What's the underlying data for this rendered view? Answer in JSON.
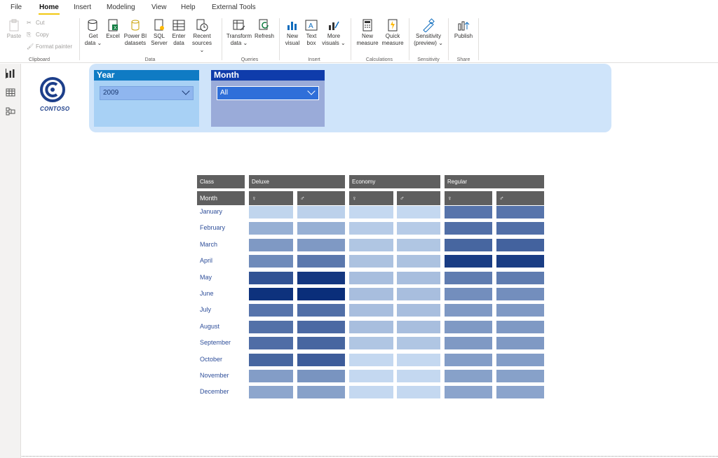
{
  "menu": {
    "tabs": [
      "File",
      "Home",
      "Insert",
      "Modeling",
      "View",
      "Help",
      "External Tools"
    ]
  },
  "ribbon": {
    "clipboard": {
      "label": "Clipboard",
      "paste": "Paste",
      "cut": "Cut",
      "copy": "Copy",
      "format_painter": "Format painter"
    },
    "data": {
      "label": "Data",
      "get_data": [
        "Get",
        "data ⌄"
      ],
      "excel": "Excel",
      "power_bi": [
        "Power BI",
        "datasets"
      ],
      "sql": [
        "SQL",
        "Server"
      ],
      "enter": [
        "Enter",
        "data"
      ],
      "recent": [
        "Recent",
        "sources ⌄"
      ]
    },
    "queries": {
      "label": "Queries",
      "transform": [
        "Transform",
        "data ⌄"
      ],
      "refresh": "Refresh"
    },
    "insert": {
      "label": "Insert",
      "new_visual": [
        "New",
        "visual"
      ],
      "text_box": [
        "Text",
        "box"
      ],
      "more_visuals": [
        "More",
        "visuals ⌄"
      ]
    },
    "calculations": {
      "label": "Calculations",
      "new_measure": [
        "New",
        "measure"
      ],
      "quick_measure": [
        "Quick",
        "measure"
      ]
    },
    "sensitivity": {
      "label": "Sensitivity",
      "sensitivity": [
        "Sensitivity",
        "(preview) ⌄"
      ]
    },
    "share": {
      "label": "Share",
      "publish": "Publish"
    }
  },
  "logo": {
    "text": "CONTOSO"
  },
  "slicers": {
    "year": {
      "title": "Year",
      "value": "2009",
      "head_color": "#0f7bc4",
      "body_color": "#a8d1f5"
    },
    "month": {
      "title": "Month",
      "value": "All",
      "head_color": "#0f3cab",
      "body_color": "#9aabd9"
    }
  },
  "matrix": {
    "corner_row1": "Class",
    "corner_row2": "Month",
    "classes": [
      "Deluxe",
      "Economy",
      "Regular"
    ],
    "gender_labels": [
      "♀",
      "♂",
      "♀",
      "♂",
      "♀",
      "♂"
    ],
    "months": [
      "January",
      "February",
      "March",
      "April",
      "May",
      "June",
      "July",
      "August",
      "September",
      "October",
      "November",
      "December"
    ],
    "intensity": [
      [
        0.1,
        0.12,
        0.08,
        0.08,
        0.62,
        0.62
      ],
      [
        0.3,
        0.3,
        0.15,
        0.15,
        0.65,
        0.65
      ],
      [
        0.42,
        0.42,
        0.18,
        0.18,
        0.7,
        0.72
      ],
      [
        0.5,
        0.6,
        0.2,
        0.2,
        0.92,
        0.92
      ],
      [
        0.8,
        0.95,
        0.22,
        0.22,
        0.58,
        0.58
      ],
      [
        0.98,
        1.0,
        0.22,
        0.22,
        0.48,
        0.48
      ],
      [
        0.62,
        0.65,
        0.22,
        0.22,
        0.42,
        0.42
      ],
      [
        0.64,
        0.68,
        0.22,
        0.22,
        0.42,
        0.42
      ],
      [
        0.66,
        0.7,
        0.18,
        0.18,
        0.42,
        0.42
      ],
      [
        0.7,
        0.75,
        0.08,
        0.08,
        0.4,
        0.4
      ],
      [
        0.4,
        0.45,
        0.08,
        0.08,
        0.38,
        0.38
      ],
      [
        0.35,
        0.38,
        0.08,
        0.08,
        0.36,
        0.36
      ]
    ],
    "color_low": "#d4e7fa",
    "color_high": "#0a2e7a"
  }
}
